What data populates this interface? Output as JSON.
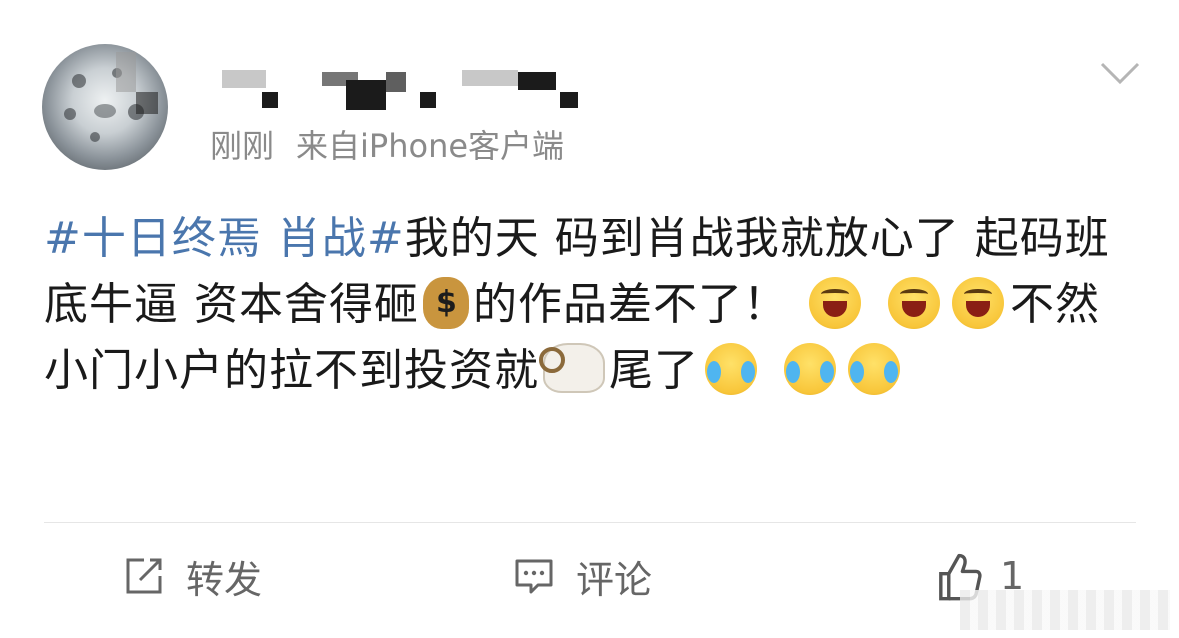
{
  "post": {
    "time": "刚刚",
    "source": "来自iPhone客户端",
    "topic": "#十日终焉 肖战#",
    "text_part1": "我的天 码到肖战我就放心了 起码班底牛逼 资本舍得砸",
    "text_part2": "的作品差不了！",
    "text_part3": "不然小门小户的拉不到投资就",
    "text_part4": "尾了"
  },
  "actions": {
    "repost_label": "转发",
    "comment_label": "评论",
    "like_count": "1"
  },
  "icons": {
    "more": "chevron-down-icon",
    "repost": "share-edit-icon",
    "comment": "comment-icon",
    "like": "thumbs-up-icon"
  },
  "colors": {
    "topic": "#4a76ad",
    "text": "#1a1a1a",
    "meta": "#8a8a8a"
  }
}
